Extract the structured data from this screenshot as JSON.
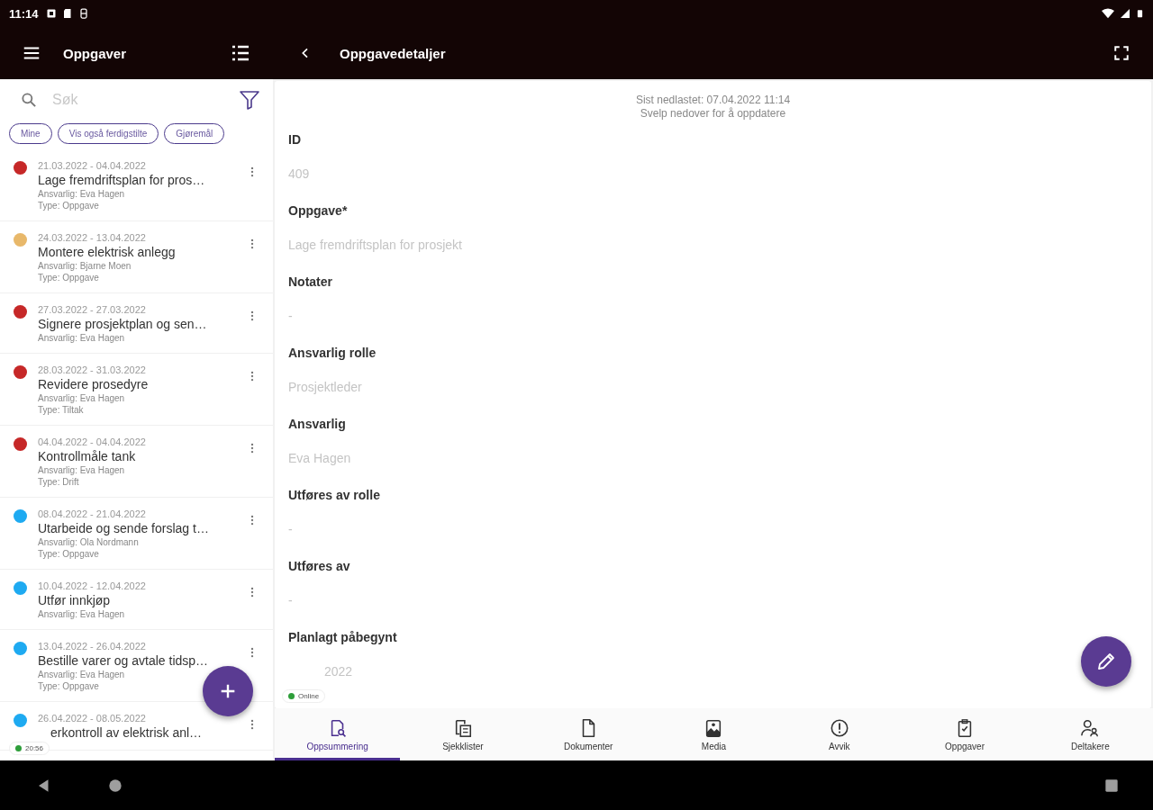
{
  "status_bar": {
    "time": "11:14"
  },
  "list_panel": {
    "title": "Oppgaver",
    "search": {
      "placeholder": "Søk"
    },
    "chips": [
      "Mine",
      "Vis også ferdigstilte",
      "Gjøremål"
    ],
    "items": [
      {
        "dates": "21.03.2022 - 04.04.2022",
        "title": "Lage fremdriftsplan for pros…",
        "lines": [
          "Ansvarlig: Eva Hagen",
          "Type: Oppgave"
        ],
        "color": "#c62828",
        "covered": false
      },
      {
        "dates": "24.03.2022 - 13.04.2022",
        "title": "Montere elektrisk anlegg",
        "lines": [
          "Ansvarlig: Bjarne Moen",
          "Type: Oppgave"
        ],
        "color": "#e8b86a",
        "covered": false
      },
      {
        "dates": "27.03.2022 - 27.03.2022",
        "title": "Signere prosjektplan og sen…",
        "lines": [
          "Ansvarlig: Eva Hagen"
        ],
        "color": "#c62828",
        "covered": false
      },
      {
        "dates": "28.03.2022 - 31.03.2022",
        "title": "Revidere prosedyre",
        "lines": [
          "Ansvarlig: Eva Hagen",
          "Type: Tiltak"
        ],
        "color": "#c62828",
        "covered": false
      },
      {
        "dates": "04.04.2022 - 04.04.2022",
        "title": "Kontrollmåle tank",
        "lines": [
          "Ansvarlig: Eva Hagen",
          "Type: Drift"
        ],
        "color": "#c62828",
        "covered": false
      },
      {
        "dates": "08.04.2022 - 21.04.2022",
        "title": "Utarbeide og sende forslag t…",
        "lines": [
          "Ansvarlig: Ola Nordmann",
          "Type: Oppgave"
        ],
        "color": "#1eaaf1",
        "covered": false
      },
      {
        "dates": "10.04.2022 - 12.04.2022",
        "title": "Utfør innkjøp",
        "lines": [
          "Ansvarlig: Eva Hagen"
        ],
        "color": "#1eaaf1",
        "covered": false
      },
      {
        "dates": "13.04.2022 - 26.04.2022",
        "title": "Bestille varer og avtale tidsp…",
        "lines": [
          "Ansvarlig: Eva Hagen",
          "Type: Oppgave"
        ],
        "color": "#1eaaf1",
        "covered": false
      },
      {
        "dates": "26.04.2022 - 08.05.2022",
        "title": "erkontroll av elektrisk anl…",
        "color": "#1eaaf1",
        "covered": true
      }
    ],
    "status_chip": {
      "label": "20:56",
      "color": "#2e9e3a"
    }
  },
  "detail_panel": {
    "title": "Oppgavedetaljer",
    "sync": [
      "Sist nedlastet: 07.04.2022 11:14",
      "Svelp nedover for å oppdatere"
    ],
    "fields": [
      {
        "label": "ID",
        "value": "409",
        "covered": false
      },
      {
        "label": "Oppgave*",
        "value": "Lage fremdriftsplan for prosjekt",
        "covered": false
      },
      {
        "label": "Notater",
        "value": "-",
        "covered": false
      },
      {
        "label": "Ansvarlig rolle",
        "value": "Prosjektleder",
        "covered": false
      },
      {
        "label": "Ansvarlig",
        "value": "Eva Hagen",
        "covered": false
      },
      {
        "label": "Utføres av rolle",
        "value": "-",
        "covered": false
      },
      {
        "label": "Utføres av",
        "value": "-",
        "covered": false
      },
      {
        "label": "Planlagt påbegynt",
        "value": "2022",
        "covered": true
      }
    ],
    "status_chip": {
      "label": "Online",
      "color": "#2e9e3a"
    }
  },
  "bottom_tabs": [
    {
      "label": "Oppsummering",
      "selected": true
    },
    {
      "label": "Sjekklister",
      "selected": false
    },
    {
      "label": "Dokumenter",
      "selected": false
    },
    {
      "label": "Media",
      "selected": false
    },
    {
      "label": "Avvik",
      "selected": false
    },
    {
      "label": "Oppgaver",
      "selected": false
    },
    {
      "label": "Deltakere",
      "selected": false
    }
  ]
}
